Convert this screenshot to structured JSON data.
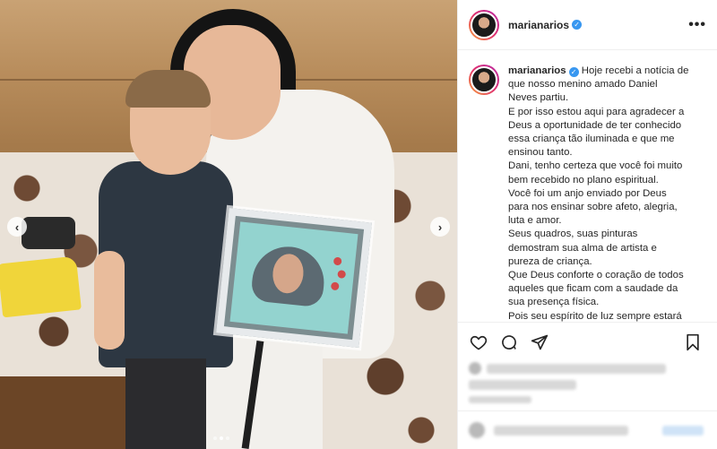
{
  "post": {
    "username": "marianarios",
    "verified": true,
    "more_icon": "more-horizontal-icon",
    "caption_username": "marianarios",
    "caption_lines": [
      "Hoje recebi a notícia de",
      "que nosso menino amado Daniel",
      "Neves partiu.",
      "E por isso estou aqui para agradecer a",
      "Deus a oportunidade de ter conhecido",
      "essa criança tão iluminada e que me",
      "ensinou tanto.",
      "Dani, tenho certeza que você foi muito",
      "bem recebido no plano espiritual.",
      "Você foi um anjo enviado por Deus",
      "para nos ensinar sobre afeto, alegria,",
      "luta e amor.",
      "Seus quadros, suas pinturas",
      "demostram sua alma de artista e",
      "pureza de criança.",
      "Que Deus conforte o coração de todos",
      "aqueles que ficam com a saudade da",
      "sua presença física.",
      "Pois seu espírito de luz sempre estará"
    ]
  },
  "carousel": {
    "prev_label": "‹",
    "next_label": "›",
    "dot_count": 3,
    "active_dot": 1
  },
  "actions": {
    "icons": [
      "heart-icon",
      "comment-icon",
      "share-icon",
      "bookmark-icon"
    ]
  },
  "colors": {
    "verified": "#3897f0",
    "text": "#262626",
    "border": "#efefef"
  }
}
